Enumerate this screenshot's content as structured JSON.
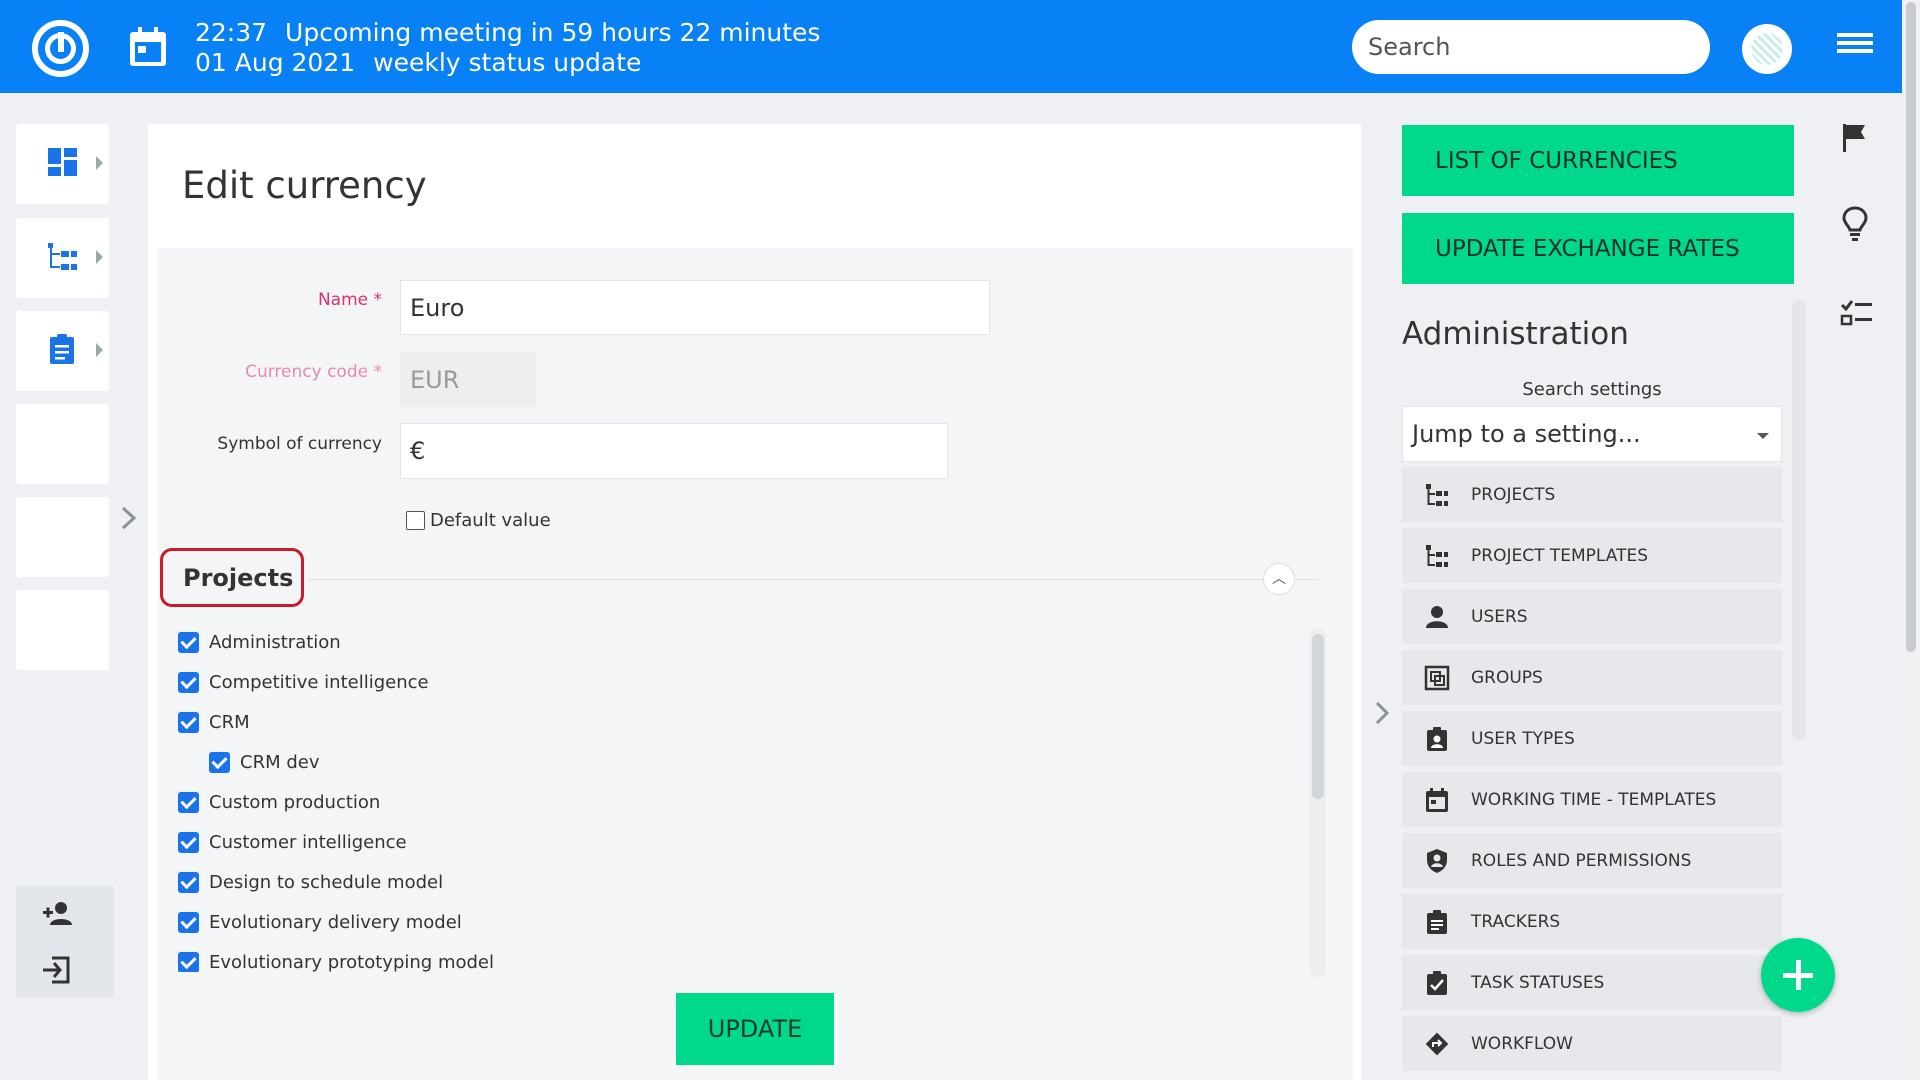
{
  "header": {
    "time": "22:37",
    "meeting": "Upcoming meeting in 59 hours 22 minutes",
    "date": "01 Aug 2021",
    "meeting_name": "weekly status update",
    "search_placeholder": "Search"
  },
  "page": {
    "title": "Edit currency"
  },
  "form": {
    "name_label": "Name *",
    "name_value": "Euro",
    "code_label": "Currency code *",
    "code_value": "EUR",
    "symbol_label": "Symbol of currency",
    "symbol_value": "€",
    "default_label": "Default value",
    "projects_title": "Projects",
    "update_label": "UPDATE"
  },
  "projects": [
    "Administration",
    "Competitive intelligence",
    "CRM",
    "CRM dev",
    "Custom production",
    "Customer intelligence",
    "Design to schedule model",
    "Evolutionary delivery model",
    "Evolutionary prototyping model"
  ],
  "sidebar": {
    "list_currencies": "LIST OF CURRENCIES",
    "update_rates": "UPDATE EXCHANGE RATES",
    "admin_title": "Administration",
    "search_label": "Search settings",
    "jump_placeholder": "Jump to a setting...",
    "items": [
      {
        "label": "PROJECTS",
        "icon": "projects-icon"
      },
      {
        "label": "PROJECT TEMPLATES",
        "icon": "project-templates-icon"
      },
      {
        "label": "USERS",
        "icon": "user-icon"
      },
      {
        "label": "GROUPS",
        "icon": "groups-icon"
      },
      {
        "label": "USER TYPES",
        "icon": "badge-icon"
      },
      {
        "label": "WORKING TIME - TEMPLATES",
        "icon": "calendar-icon"
      },
      {
        "label": "ROLES AND PERMISSIONS",
        "icon": "shield-icon"
      },
      {
        "label": "TRACKERS",
        "icon": "clipboard-icon"
      },
      {
        "label": "TASK STATUSES",
        "icon": "clipboard-check-icon"
      },
      {
        "label": "WORKFLOW",
        "icon": "workflow-icon"
      }
    ]
  },
  "colors": {
    "primary": "#0781f5",
    "accent_green": "#00d88c",
    "required": "#d6336c",
    "checkbox": "#1a73e8",
    "highlight": "#cc1a2a"
  }
}
